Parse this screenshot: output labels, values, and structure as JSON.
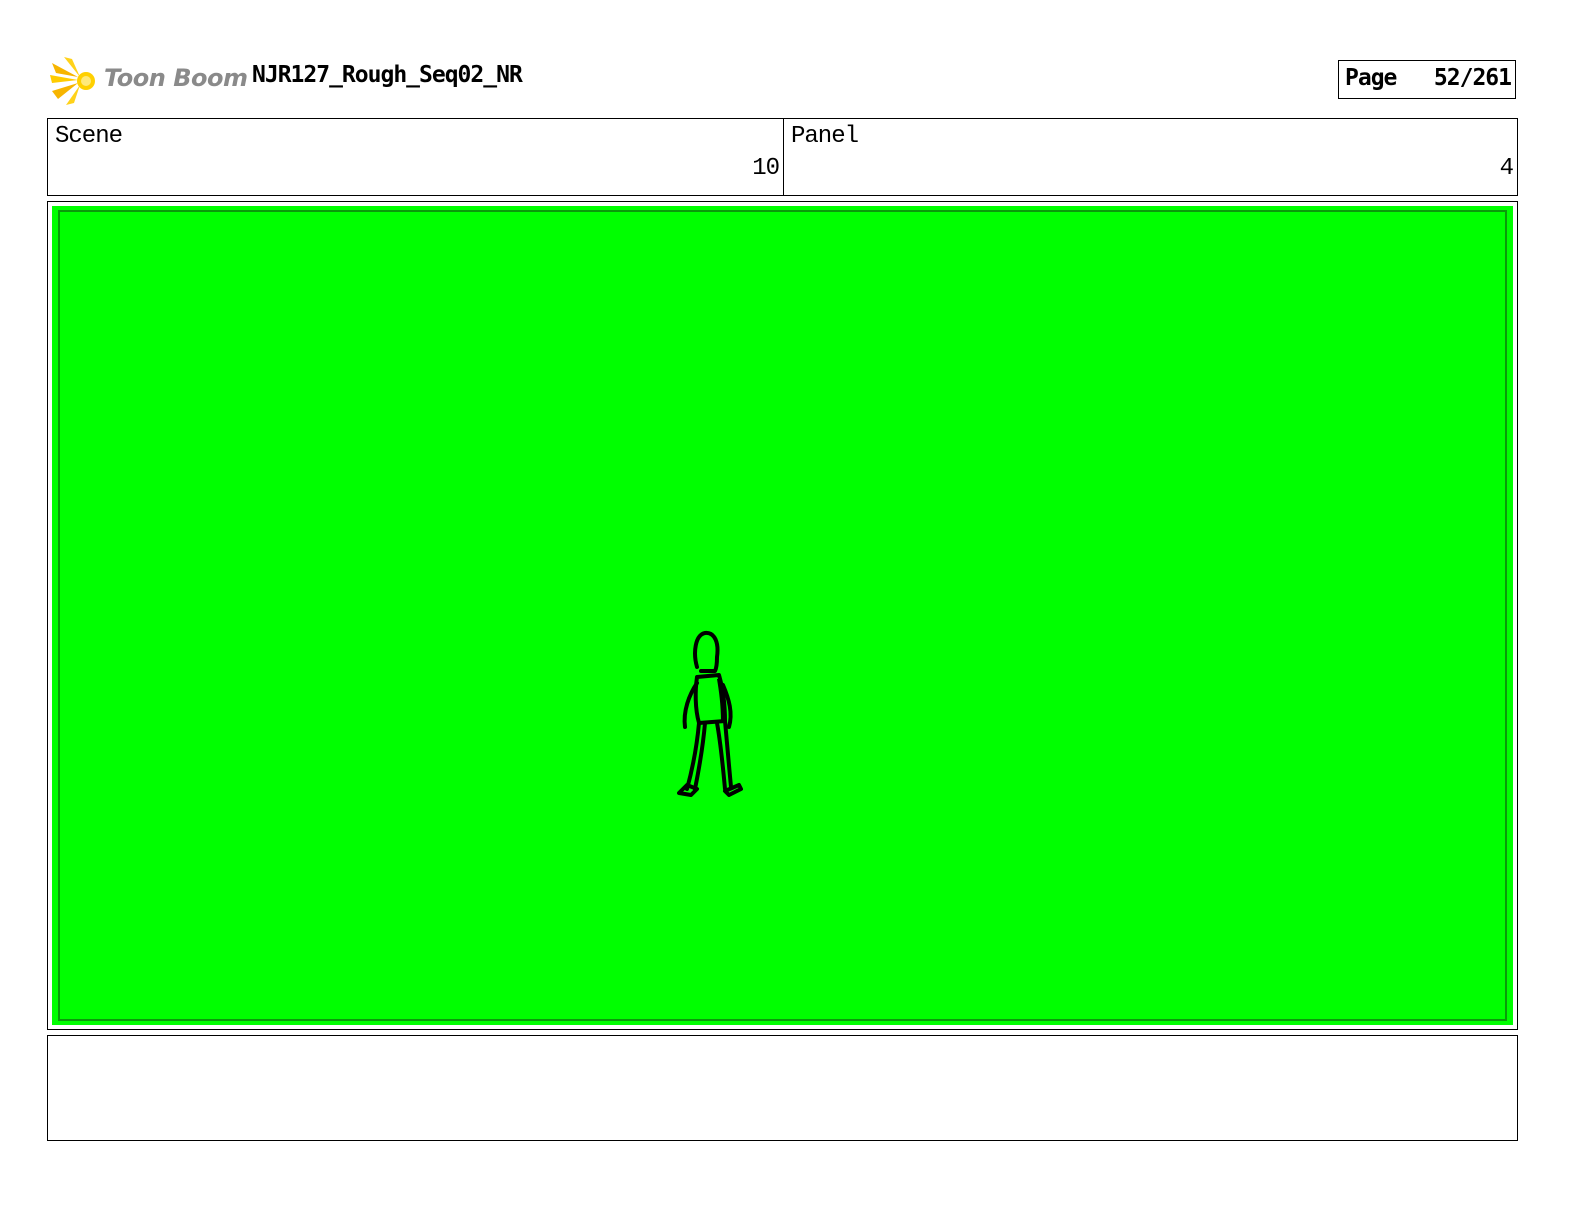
{
  "header": {
    "logo_text": "Toon Boom",
    "title": "NJR127_Rough_Seq02_NR",
    "page_label": "Page",
    "page_value": "52/261"
  },
  "info": {
    "scene_label": "Scene",
    "scene_value": "10",
    "panel_label": "Panel",
    "panel_value": "4"
  },
  "frame": {
    "background_color": "#00ff00",
    "drawing_icon": "walking-stick-figure-sketch"
  },
  "notes": {
    "text": ""
  }
}
